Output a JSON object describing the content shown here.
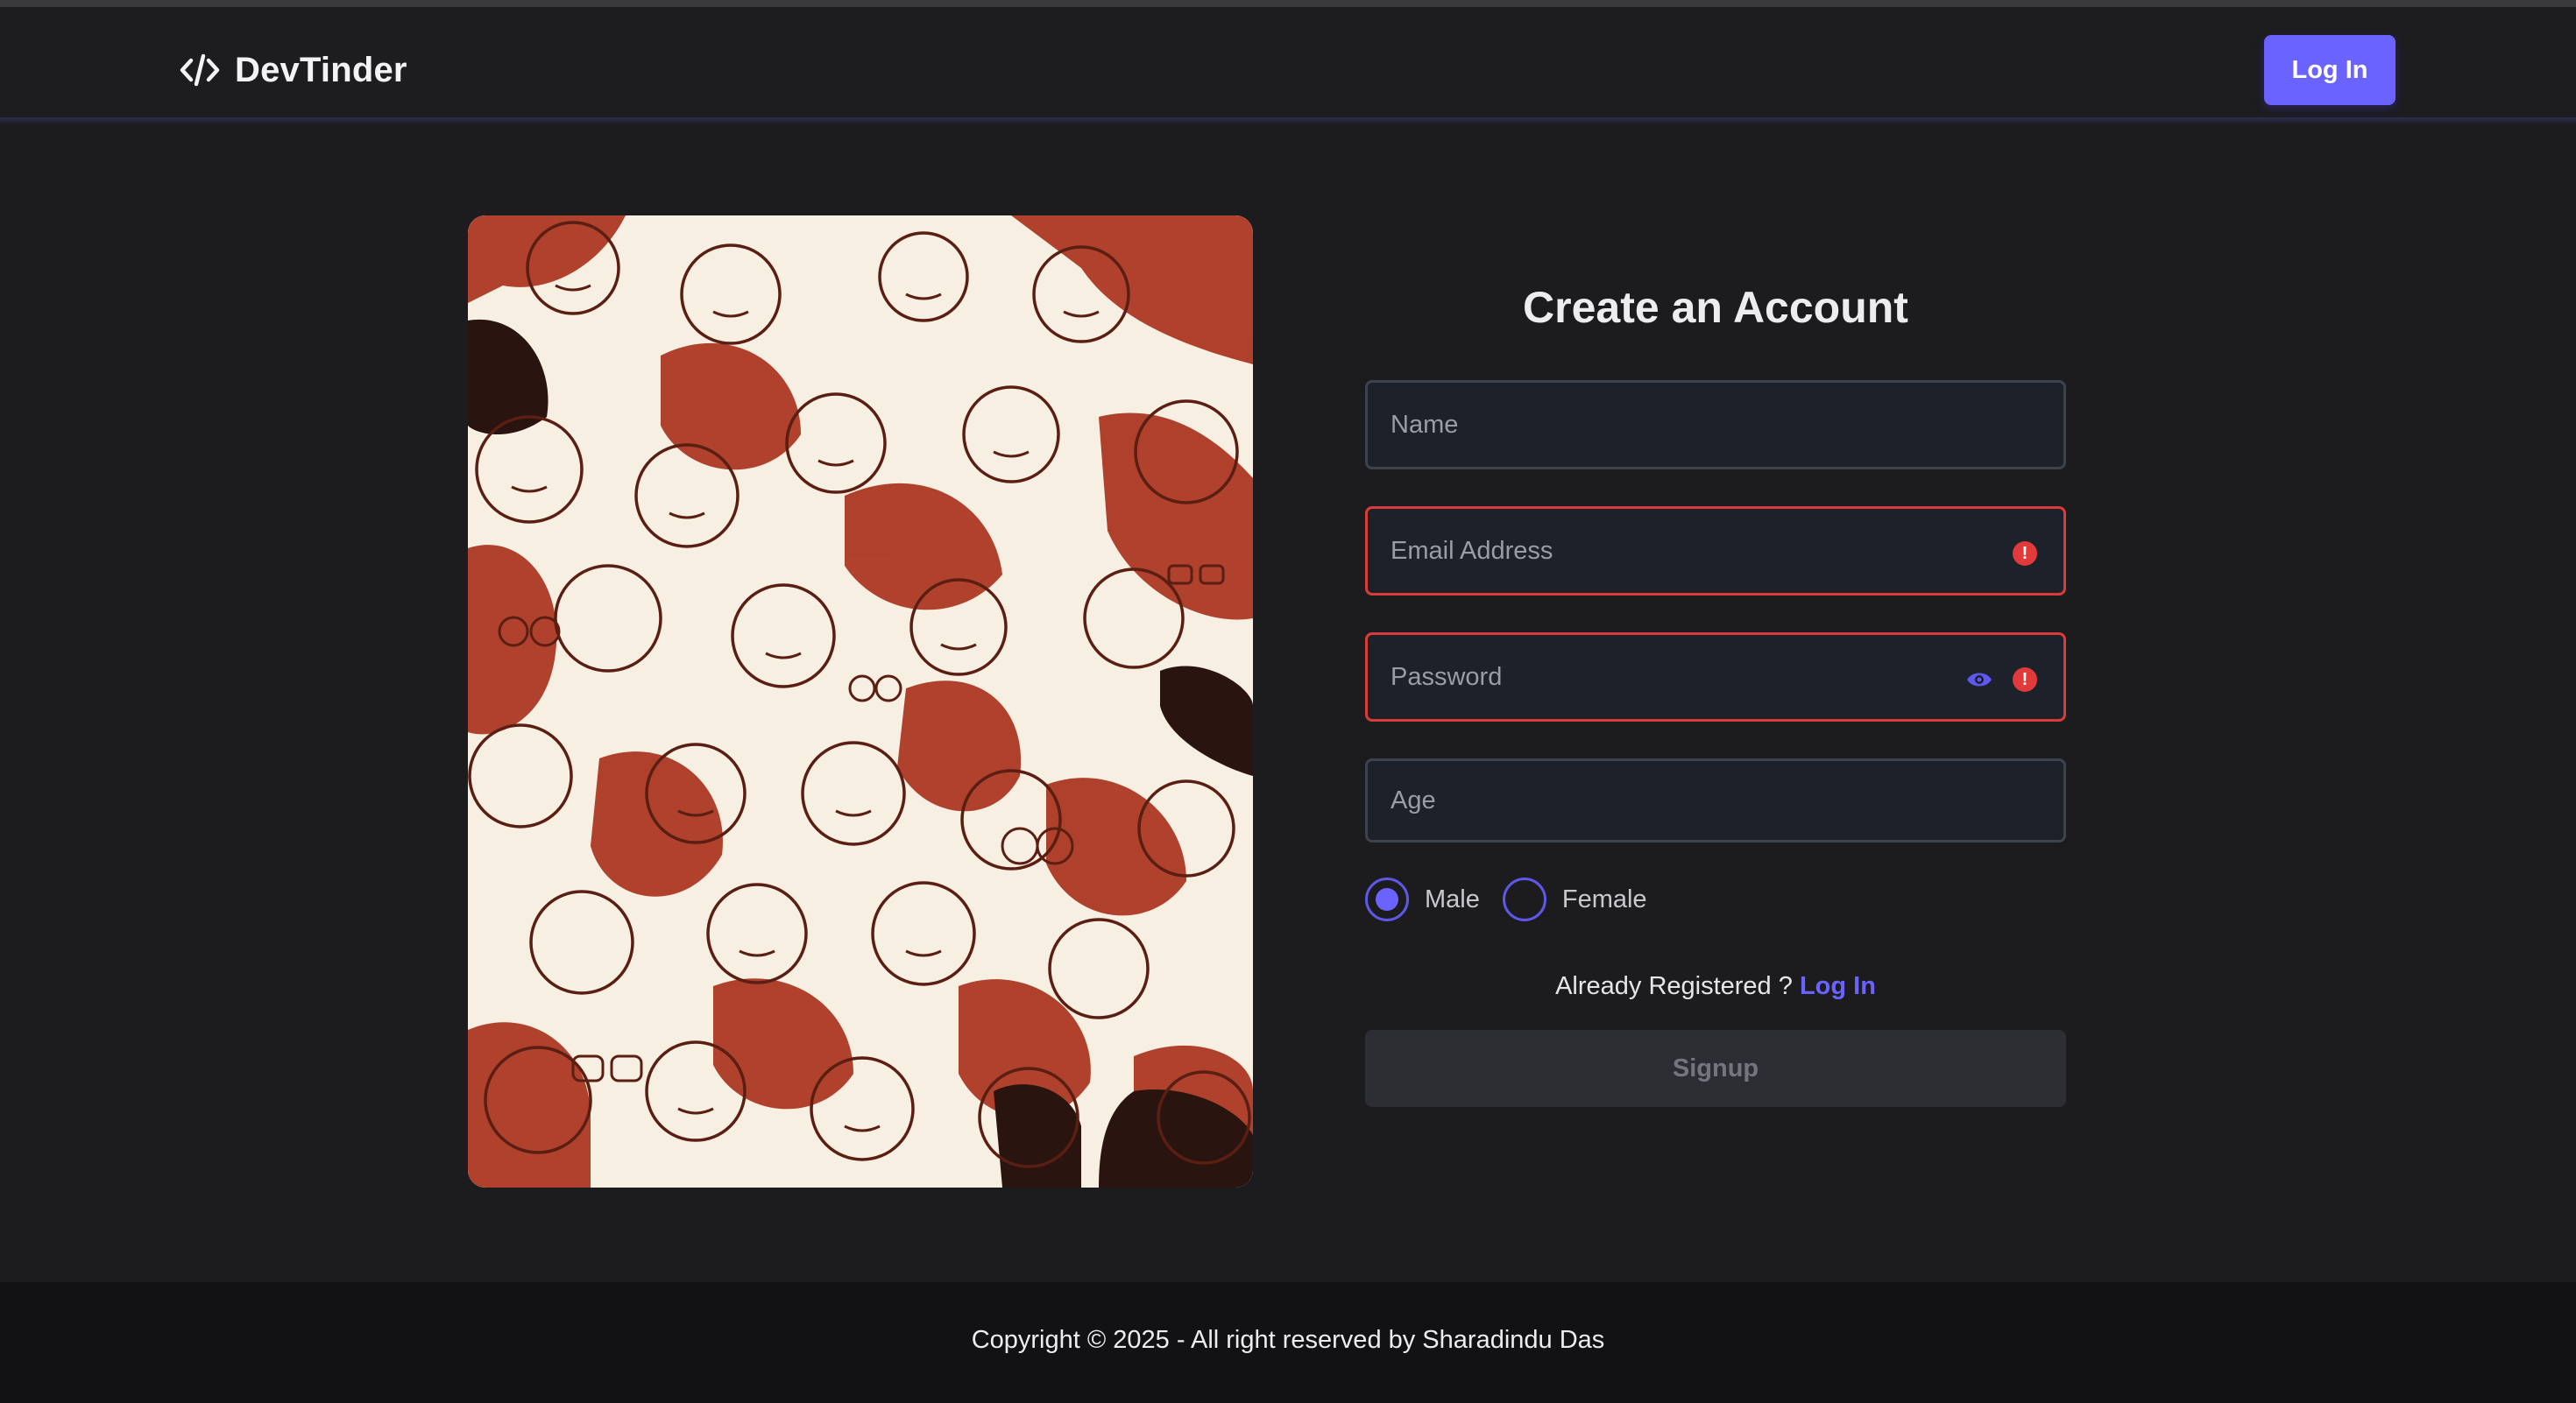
{
  "navbar": {
    "brand": "DevTinder",
    "brand_icon": "code-icon",
    "login_label": "Log In"
  },
  "illustration": {
    "icon": "crowd-of-faces-illustration"
  },
  "form": {
    "title": "Create an Account",
    "name_placeholder": "Name",
    "email_placeholder": "Email Address",
    "password_placeholder": "Password",
    "age_placeholder": "Age",
    "error_glyph": "!",
    "gender_options": [
      {
        "label": "Male",
        "checked": true
      },
      {
        "label": "Female",
        "checked": false
      }
    ],
    "already_text": "Already Registered ? ",
    "login_link": "Log In",
    "signup_label": "Signup"
  },
  "footer": {
    "text": "Copyright © 2025 - All right reserved by Sharadindu Das"
  },
  "colors": {
    "accent": "#6a63ff",
    "error": "#e23a3a",
    "background": "#1c1c1f",
    "illustration_red": "#a8321d",
    "illustration_cream": "#f6efe2"
  }
}
